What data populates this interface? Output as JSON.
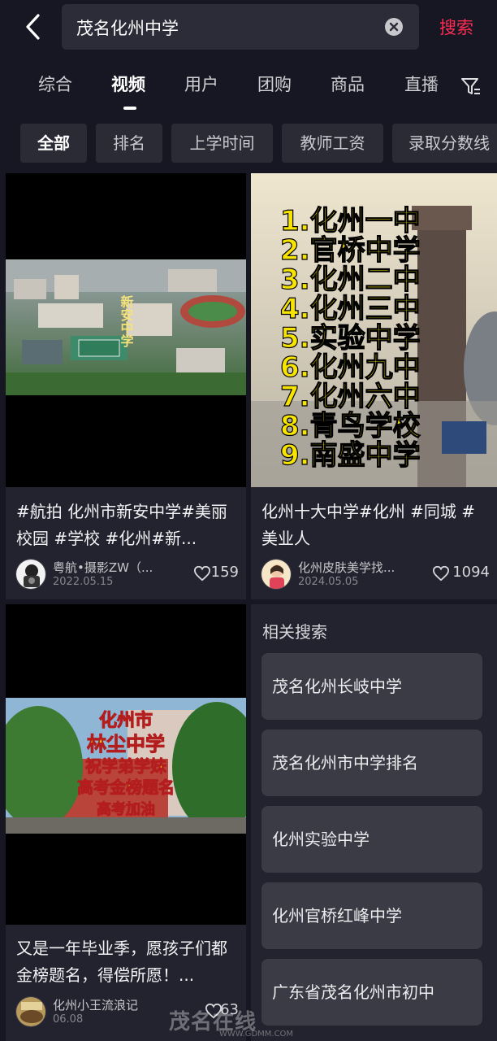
{
  "header": {
    "search_query": "茂名化州中学",
    "search_button": "搜索"
  },
  "tabs": [
    {
      "label": "综合"
    },
    {
      "label": "视频"
    },
    {
      "label": "用户"
    },
    {
      "label": "团购"
    },
    {
      "label": "商品"
    },
    {
      "label": "直播"
    }
  ],
  "chips": [
    {
      "label": "全部"
    },
    {
      "label": "排名"
    },
    {
      "label": "上学时间"
    },
    {
      "label": "教师工资"
    },
    {
      "label": "录取分数线"
    }
  ],
  "cards": [
    {
      "title": "#航拍 化州市新安中学#美丽校园 #学校 #化州#新...",
      "thumb_text": "新安中学",
      "author": "粤航•摄影ZW（...",
      "date": "2022.05.15",
      "likes": "159"
    },
    {
      "title": "化州十大中学#化州 #同城 #美业人",
      "thumb_list": [
        "1.化州一中",
        "2.官桥中学",
        "3.化州二中",
        "4.化州三中",
        "5.实验中学",
        "6.化州九中",
        "7.化州六中",
        "8.青鸟学校",
        "9.南盛中学"
      ],
      "author": "化州皮肤美学找...",
      "date": "2024.05.05",
      "likes": "1094"
    },
    {
      "title": "又是一年毕业季，愿孩子们都金榜题名，得偿所愿！...",
      "thumb_lines": [
        "化州市",
        "林尘中学",
        "祝学弟学妹",
        "高考金榜题名",
        "高考加油"
      ],
      "author": "化州小王流浪记",
      "date": "06.08",
      "likes": "63"
    }
  ],
  "related": {
    "title": "相关搜索",
    "items": [
      {
        "label": "茂名化州长岐中学"
      },
      {
        "label": "茂名化州市中学排名"
      },
      {
        "label": "化州实验中学"
      },
      {
        "label": "化州官桥红峰中学"
      },
      {
        "label": "广东省茂名化州市初中"
      }
    ]
  },
  "watermark": {
    "text": "茂名在线",
    "sub": "WWW.GDMM.COM"
  },
  "colors": {
    "accent": "#fe2c55",
    "background": "#161722",
    "card": "#22232e"
  }
}
